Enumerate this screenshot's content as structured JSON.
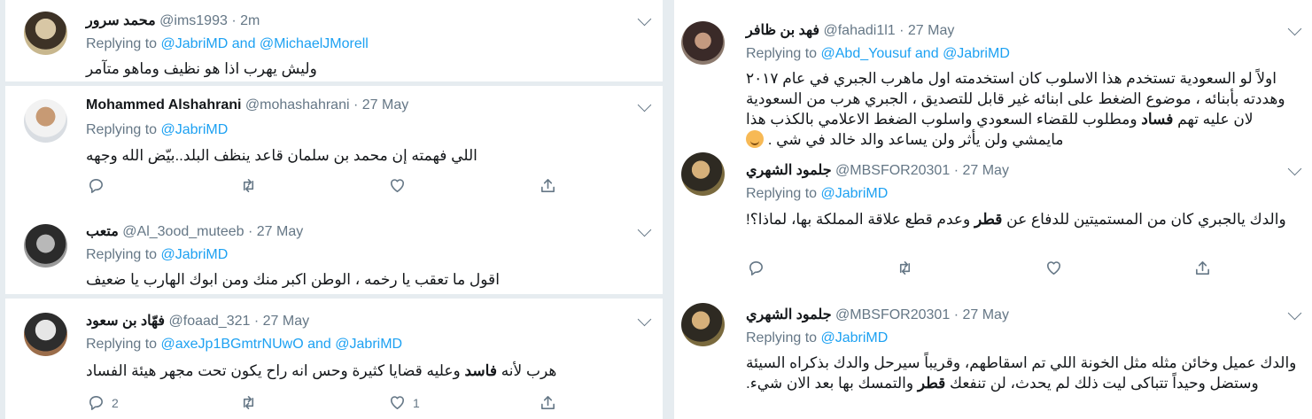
{
  "left_tweets": [
    {
      "name": "محمد سرور",
      "handle": "@ims1993",
      "time": "2m",
      "replying_prefix": "Replying to",
      "mentions": [
        "@JabriMD",
        "@MichaelJMorell"
      ],
      "text": "وليش يهرب اذا هو نظيف وماهو متآمر"
    },
    {
      "name": "Mohammed Alshahrani",
      "handle": "@mohashahrani",
      "time": "27 May",
      "replying_prefix": "Replying to",
      "mentions": [
        "@JabriMD"
      ],
      "text": "اللي فهمته إن محمد بن سلمان قاعد ينظف البلد..بيّض الله وجهه"
    },
    {
      "name": "متعب",
      "handle": "@Al_3ood_muteeb",
      "time": "27 May",
      "replying_prefix": "Replying to",
      "mentions": [
        "@JabriMD"
      ],
      "text": "اقول ما تعقب يا رخمه ، الوطن اكبر منك ومن ابوك الهارب يا ضعيف"
    },
    {
      "name": "فهّاد بن سعود",
      "handle": "@foaad_321",
      "time": "27 May",
      "replying_prefix": "Replying to",
      "mentions": [
        "@axeJp1BGmtrNUwO",
        "@JabriMD"
      ],
      "text_parts": [
        "هرب لأنه ",
        "فاسد",
        " وعليه قضايا كثيرة وحس انه راح يكون تحت مجهر هيئة الفساد"
      ],
      "reply_count": "2",
      "like_count": "1"
    }
  ],
  "right_tweets": [
    {
      "name": "فهد بن ظافر",
      "handle": "@fahadi1l1",
      "time": "27 May",
      "replying_prefix": "Replying to",
      "mentions": [
        "@Abd_Yousuf",
        "@JabriMD"
      ],
      "text_parts": [
        "اولاً لو السعودية تستخدم هذا الاسلوب كان استخدمته اول ماهرب الجبري في عام ٢٠١٧ وهددته بأبنائه ، موضوع الضغط على ابنائه غير قابل للتصديق ، الجبري هرب من السعودية لان عليه تهم ",
        "فساد",
        " ومطلوب للقضاء السعودي واسلوب الضغط الاعلامي بالكذب هذا مايمشي ولن يأثر ولن يساعد والد خالد في شي ."
      ],
      "emoji": "smiling-face"
    },
    {
      "name": "جلمود الشهري",
      "handle": "@MBSFOR20301",
      "time": "27 May",
      "replying_prefix": "Replying to",
      "mentions": [
        "@JabriMD"
      ],
      "text_parts": [
        "والدك يالجبري كان من المستميتين للدفاع عن ",
        "قطر",
        " وعدم قطع علاقة المملكة بها، لماذا؟!"
      ]
    },
    {
      "name": "جلمود الشهري",
      "handle": "@MBSFOR20301",
      "time": "27 May",
      "replying_prefix": "Replying to",
      "mentions": [
        "@JabriMD"
      ],
      "text_parts": [
        "والدك عميل وخائن مثله مثل الخونة اللي تم اسقاطهم، وقريباً سيرحل والدك بذكراه السيئة وستضل وحيداً تتباكى ليت ذلك لم يحدث، لن تنفعك ",
        "قطر",
        " والتمسك بها بعد الان شيء."
      ]
    }
  ],
  "ui": {
    "and_word": "and",
    "dot": "·"
  },
  "colors": {
    "link": "#1da1f2",
    "muted": "#657786",
    "background": "#e6ecf0"
  }
}
